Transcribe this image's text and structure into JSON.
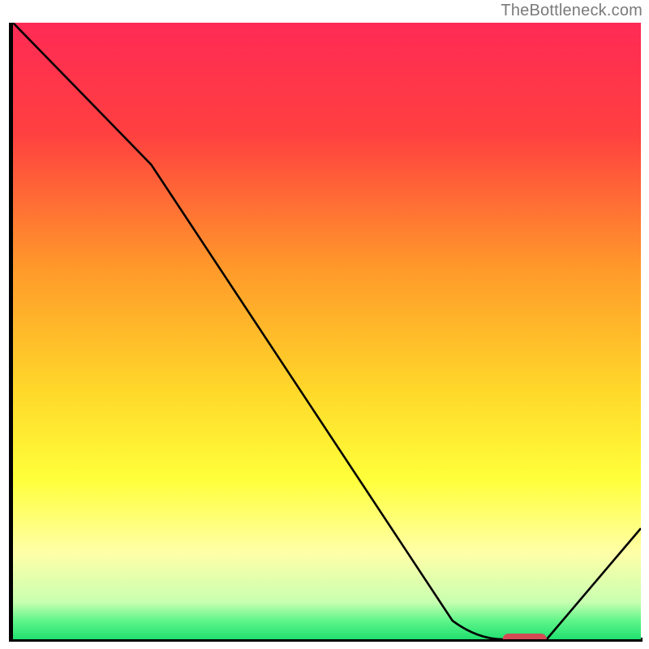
{
  "watermark": "TheBottleneck.com",
  "chart_data": {
    "type": "line",
    "title": "",
    "xlabel": "",
    "ylabel": "",
    "xlim": [
      0,
      100
    ],
    "ylim": [
      0,
      100
    ],
    "gradient_stops": [
      {
        "offset": 0,
        "color": "#ff2a55"
      },
      {
        "offset": 18,
        "color": "#ff4040"
      },
      {
        "offset": 40,
        "color": "#ff9a2a"
      },
      {
        "offset": 60,
        "color": "#ffd92a"
      },
      {
        "offset": 74,
        "color": "#ffff3a"
      },
      {
        "offset": 86,
        "color": "#ffffa8"
      },
      {
        "offset": 94,
        "color": "#c8ffb0"
      },
      {
        "offset": 97,
        "color": "#5ff58a"
      },
      {
        "offset": 100,
        "color": "#20e070"
      }
    ],
    "series": [
      {
        "name": "bottleneck-curve",
        "x": [
          0,
          22,
          70,
          78,
          85,
          100
        ],
        "y": [
          100,
          77,
          3,
          0,
          0,
          18
        ]
      }
    ],
    "marker": {
      "name": "optimal-range",
      "x_start": 78,
      "x_end": 85,
      "y": 0,
      "color": "#d34a54"
    }
  }
}
